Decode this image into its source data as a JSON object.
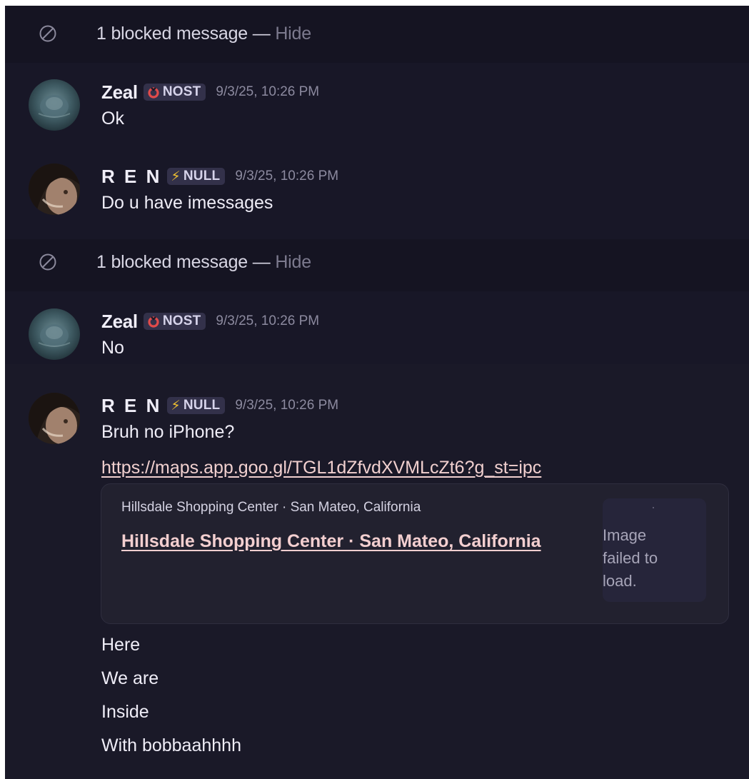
{
  "blocked_notices": [
    {
      "text": "1 blocked message",
      "separator": "—",
      "action": "Hide"
    },
    {
      "text": "1 blocked message",
      "separator": "—",
      "action": "Hide"
    }
  ],
  "messages": [
    {
      "user": "Zeal",
      "tag": "NOST",
      "tag_icon": "ring-icon",
      "timestamp": "9/3/25, 10:26 PM",
      "lines": [
        "Ok"
      ]
    },
    {
      "user": "R E N",
      "tag": "NULL",
      "tag_icon": "lightning-icon",
      "timestamp": "9/3/25, 10:26 PM",
      "lines": [
        "Do u have imessages"
      ]
    },
    {
      "user": "Zeal",
      "tag": "NOST",
      "tag_icon": "ring-icon",
      "timestamp": "9/3/25, 10:26 PM",
      "lines": [
        "No"
      ]
    },
    {
      "user": "R E N",
      "tag": "NULL",
      "tag_icon": "lightning-icon",
      "timestamp": "9/3/25, 10:26 PM",
      "lines": [
        "Bruh no iPhone?"
      ],
      "link": "https://maps.app.goo.gl/TGL1dZfvdXVMLcZt6?g_st=ipc",
      "embed": {
        "provider": "Hillsdale Shopping Center · San Mateo, California",
        "title": "Hillsdale Shopping Center · San Mateo, California",
        "thumbnail_dot": "·",
        "image_error": "Image failed to load."
      },
      "followups": [
        "Here",
        "We are",
        "Inside",
        "With bobbaahhhh"
      ]
    }
  ],
  "colors": {
    "background": "#1a1928",
    "hide_link": "#7c7a8e",
    "link": "#f1d0cf",
    "tag_bg": "#33314a",
    "ring_icon": "#e14b4b",
    "lightning_icon": "#f2c230"
  }
}
